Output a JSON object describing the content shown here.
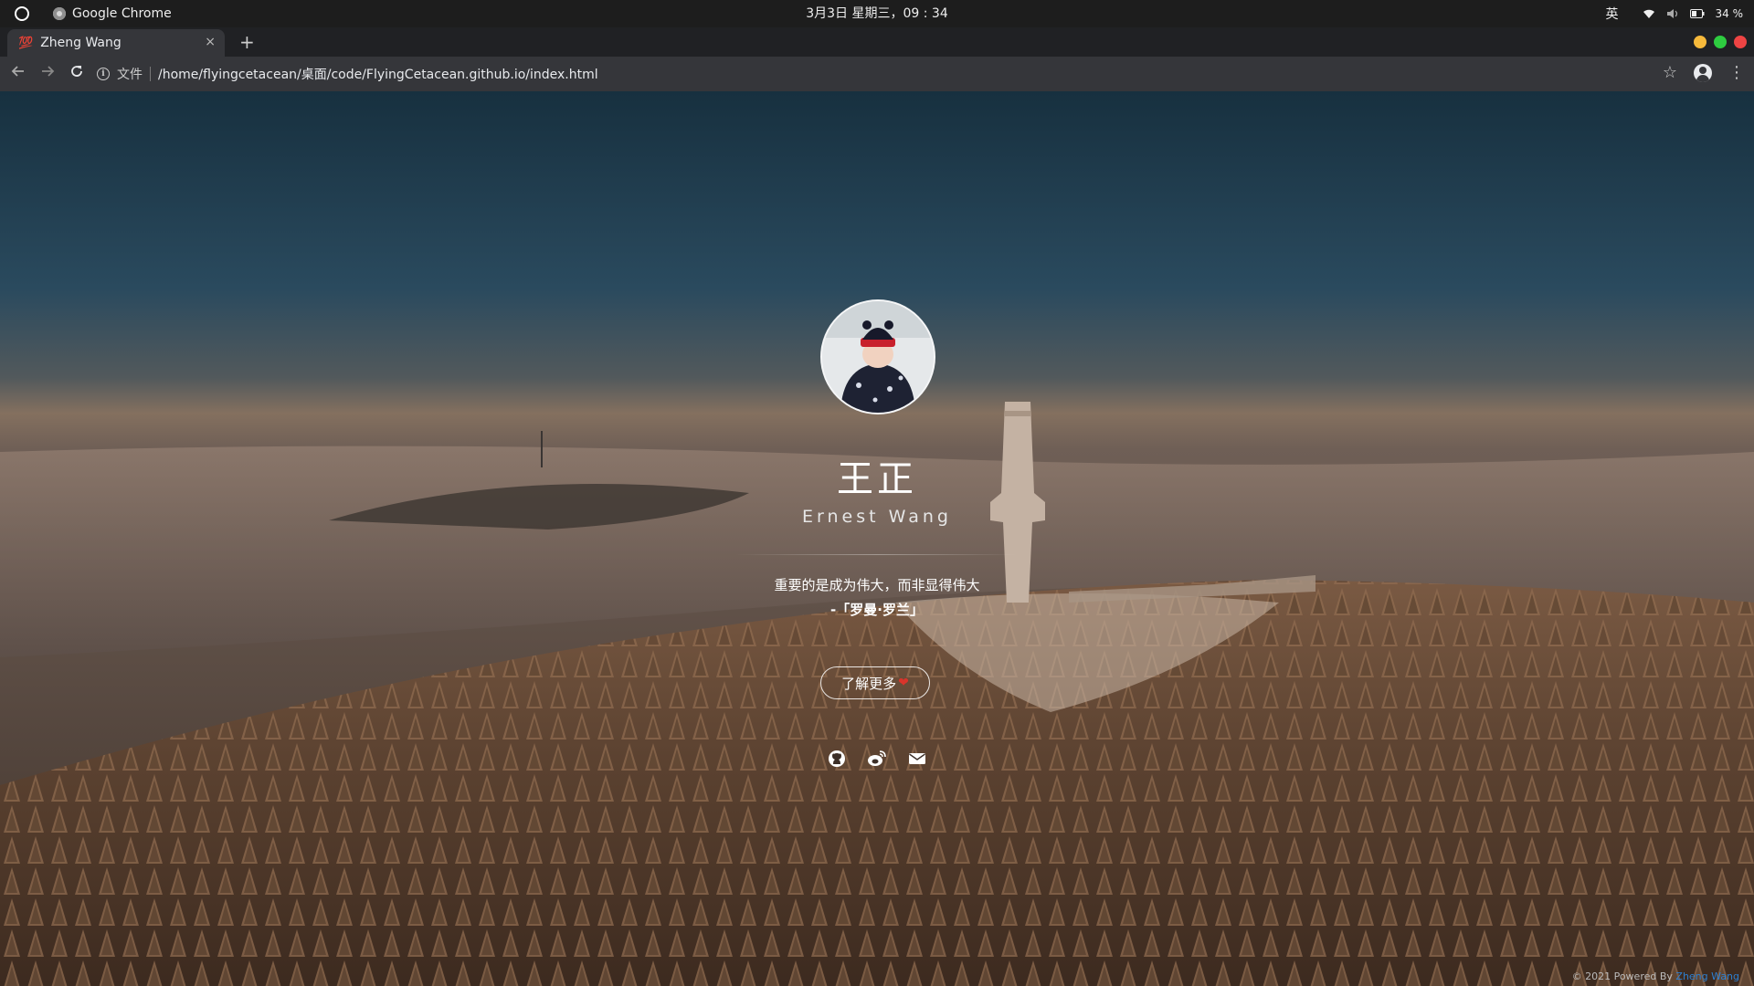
{
  "system": {
    "app_name": "Google Chrome",
    "datetime": "3月3日 星期三，09 : 34",
    "ime": "英",
    "battery": "34 %"
  },
  "browser": {
    "tab_title": "Zheng Wang",
    "tab_close": "×",
    "new_tab": "+",
    "file_label": "文件",
    "url": "/home/flyingcetacean/桌面/code/FlyingCetacean.github.io/index.html"
  },
  "profile": {
    "name_cn": "王正",
    "name_en": "Ernest Wang",
    "quote": "重要的是成为伟大，而非显得伟大",
    "quote_author": "-「罗曼·罗兰」",
    "more_button": "了解更多",
    "more_icon": "heart-icon",
    "social_icons": [
      "github-icon",
      "weibo-icon",
      "mail-icon"
    ]
  },
  "footer": {
    "text": "© 2021 Powered By ",
    "link": "Zheng Wang"
  },
  "colors": {
    "accent_link": "#2d7fd0",
    "heart": "#d9342b",
    "traffic_min": "#f6b93b",
    "traffic_max": "#2ecc40",
    "traffic_close": "#ee4444"
  }
}
